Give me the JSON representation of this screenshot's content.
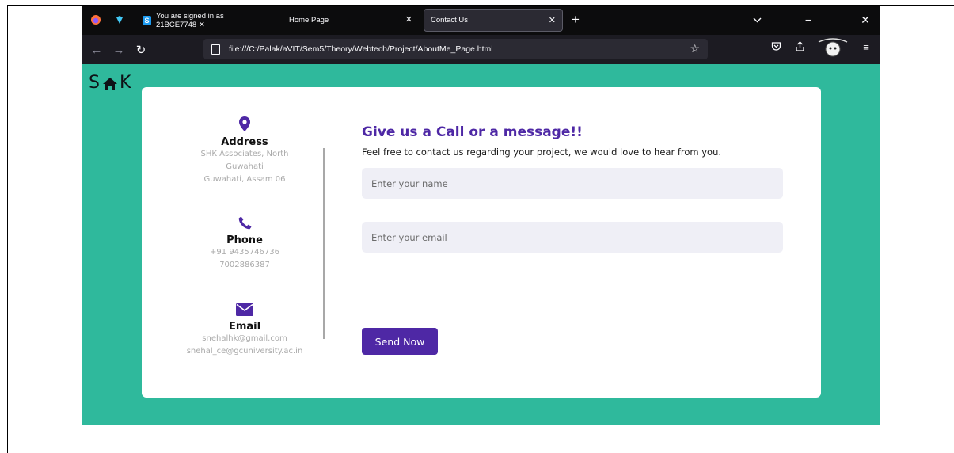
{
  "browser": {
    "tabs": [
      {
        "label": "You are signed in as 21BCE7748 ✕",
        "favicon": "S"
      },
      {
        "label": "Home Page",
        "close": "✕"
      },
      {
        "label": "Contact Us",
        "close": "✕"
      }
    ],
    "new_tab": "+",
    "url": "file:///C:/Palak/aVIT/Sem5/Theory/Webtech/Project/AboutMe_Page.html",
    "window_controls": {
      "minimize": "−",
      "close": "✕"
    },
    "icons": [
      "firefox-icon",
      "extension-icon",
      "back-icon",
      "forward-icon",
      "reload-icon",
      "document-icon",
      "bookmark-star-icon",
      "pocket-icon",
      "share-icon",
      "avatar-icon",
      "menu-icon"
    ]
  },
  "page": {
    "logo_left": "S",
    "logo_right": "K",
    "address": {
      "title": "Address",
      "lines": [
        "SHK Associates, North",
        "Guwahati",
        "Guwahati, Assam 06"
      ]
    },
    "phone": {
      "title": "Phone",
      "lines": [
        "+91 9435746736",
        "7002886387"
      ]
    },
    "email": {
      "title": "Email",
      "lines": [
        "snehalhk@gmail.com",
        "snehal_ce@gcuniversity.ac.in"
      ]
    },
    "form": {
      "title": "Give us a Call or a message!!",
      "subtitle": "Feel free to contact us regarding your project, we would love to hear from you.",
      "name_placeholder": "Enter your name",
      "email_placeholder": "Enter your email",
      "send_label": "Send Now"
    }
  },
  "colors": {
    "background": "#2fb99c",
    "accent": "#4e28a5",
    "input_bg": "#efeff6"
  }
}
